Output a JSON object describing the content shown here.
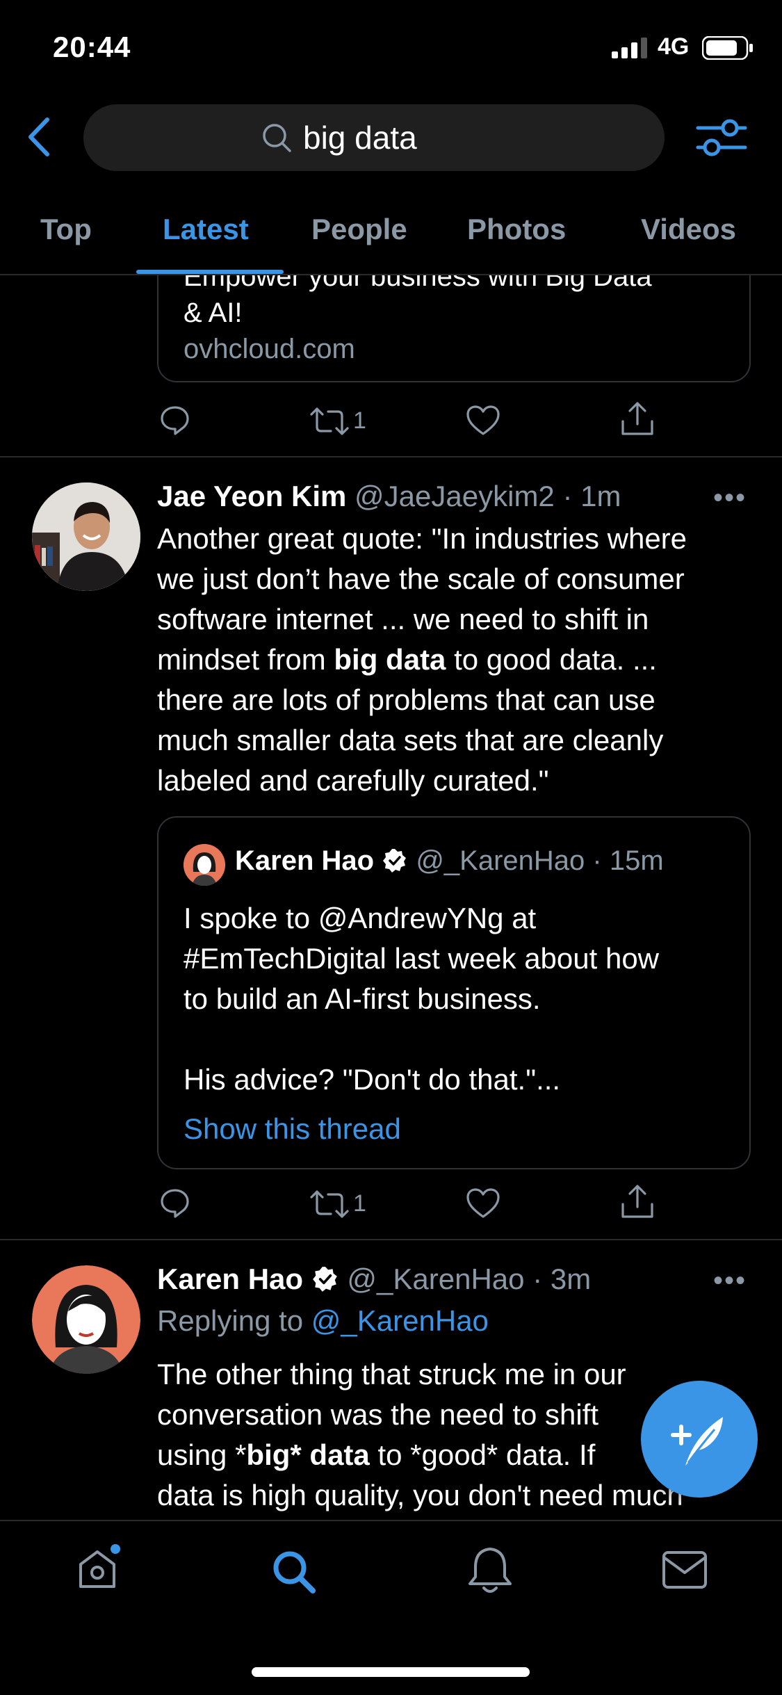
{
  "status_bar": {
    "time": "20:44",
    "network": "4G"
  },
  "search": {
    "query": "big data"
  },
  "tabs": [
    {
      "label": "Top"
    },
    {
      "label": "Latest"
    },
    {
      "label": "People"
    },
    {
      "label": "Photos"
    },
    {
      "label": "Videos"
    }
  ],
  "ad_card": {
    "text_line1": "Empower your business with Big Data",
    "text_line2": "& AI!",
    "domain": "ovhcloud.com",
    "retweet_count": "1"
  },
  "tweet1": {
    "name": "Jae Yeon Kim",
    "handle": "@JaeJaeykim2",
    "time": "1m",
    "lines": [
      "Another great quote: \"In industries where",
      "we just don’t have the scale of consumer",
      "software internet ... we need to shift in"
    ],
    "line4_pre": "mindset from ",
    "line4_bold": "big data",
    "line4_post": " to good data. ...",
    "lines_end": [
      "there are lots of problems that can use",
      "much smaller data sets that are cleanly",
      "labeled and carefully curated.\""
    ],
    "quote": {
      "name": "Karen Hao",
      "handle": "@_KarenHao",
      "time": "15m",
      "lines": [
        "I spoke to @AndrewYNg at",
        "#EmTechDigital last week about how",
        "to build an AI-first business."
      ],
      "line_after_gap": "His advice? \"Don't do that.\"...",
      "show_thread": "Show this thread"
    },
    "retweet_count": "1"
  },
  "tweet2": {
    "name": "Karen Hao",
    "handle": "@_KarenHao",
    "time": "3m",
    "replying_prefix": "Replying to",
    "replying_to": "@_KarenHao",
    "line1": "The other thing that struck me in our",
    "line2": "conversation was the need to shift",
    "line3_pre": "using *",
    "line3_bold": "big* data",
    "line3_post": " to *good* data. If",
    "line4": "data is high quality, you don't need much"
  },
  "colors": {
    "accent": "#3a95e6",
    "muted": "#8b98a5",
    "background": "#000000"
  },
  "icons": {
    "bottom_nav": [
      "home-icon",
      "search-icon",
      "bell-icon",
      "mail-icon"
    ],
    "fab": "compose-icon"
  }
}
